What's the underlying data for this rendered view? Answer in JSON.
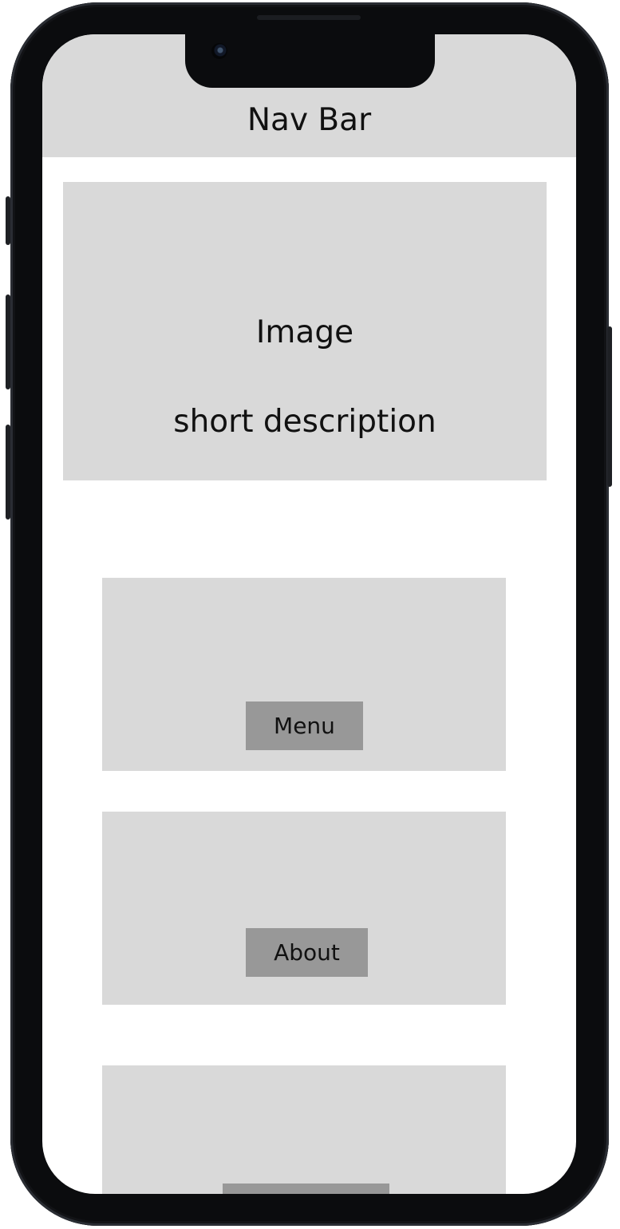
{
  "device": {
    "frame_color": "#0b0c0e"
  },
  "screen": {
    "nav_bar": {
      "title": "Nav Bar"
    },
    "hero": {
      "title": "Image",
      "description": "short description"
    },
    "cards": [
      {
        "button_label": "Menu"
      },
      {
        "button_label": "About"
      },
      {
        "button_label": ""
      }
    ]
  },
  "colors": {
    "placeholder_bg": "#d9d9d9",
    "button_bg": "#989898",
    "text": "#111111"
  }
}
